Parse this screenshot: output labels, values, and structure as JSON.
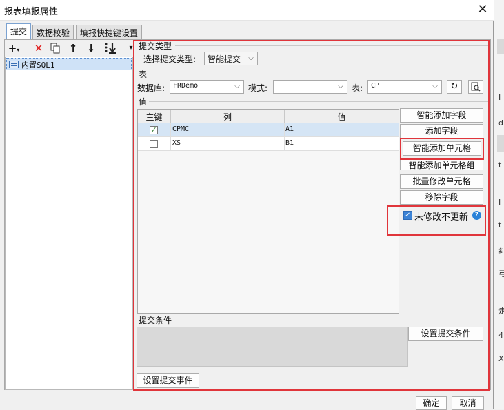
{
  "window": {
    "title": "报表填报属性"
  },
  "tabs": [
    {
      "label": "提交",
      "active": true
    },
    {
      "label": "数据校验",
      "active": false
    },
    {
      "label": "填报快捷键设置",
      "active": false
    }
  ],
  "left_list": {
    "items": [
      {
        "label": "内置SQL1"
      }
    ]
  },
  "submit_type": {
    "group_label": "提交类型",
    "label": "选择提交类型:",
    "value": "智能提交"
  },
  "table_section": {
    "group_label": "表",
    "db_label": "数据库:",
    "db_value": "FRDemo",
    "schema_label": "模式:",
    "schema_value": "",
    "table_label": "表:",
    "table_value": "CP"
  },
  "value_section": {
    "group_label": "值",
    "columns": [
      "主键",
      "列",
      "值"
    ],
    "rows": [
      {
        "key": true,
        "column": "CPMC",
        "value": "A1"
      },
      {
        "key": false,
        "column": "XS",
        "value": "B1"
      }
    ]
  },
  "side_buttons": {
    "smart_add_field": "智能添加字段",
    "add_field": "添加字段",
    "smart_add_cell": "智能添加单元格",
    "smart_add_cell_group": "智能添加单元格组",
    "batch_modify_cell": "批量修改单元格",
    "remove_field": "移除字段"
  },
  "no_update_unmodified": {
    "label": "未修改不更新",
    "checked": true
  },
  "submit_condition": {
    "group_label": "提交条件",
    "button": "设置提交条件"
  },
  "submit_event_button": "设置提交事件",
  "footer": {
    "ok": "确定",
    "cancel": "取消"
  },
  "background_app": {
    "glyphs": [
      "I",
      "d",
      "t",
      "I",
      "t",
      "纟",
      "弓",
      "走",
      "4",
      "X"
    ]
  },
  "colors": {
    "highlight_red": "#e0353b",
    "accent_blue": "#3c83d6",
    "selection": "#cfe2f7"
  }
}
